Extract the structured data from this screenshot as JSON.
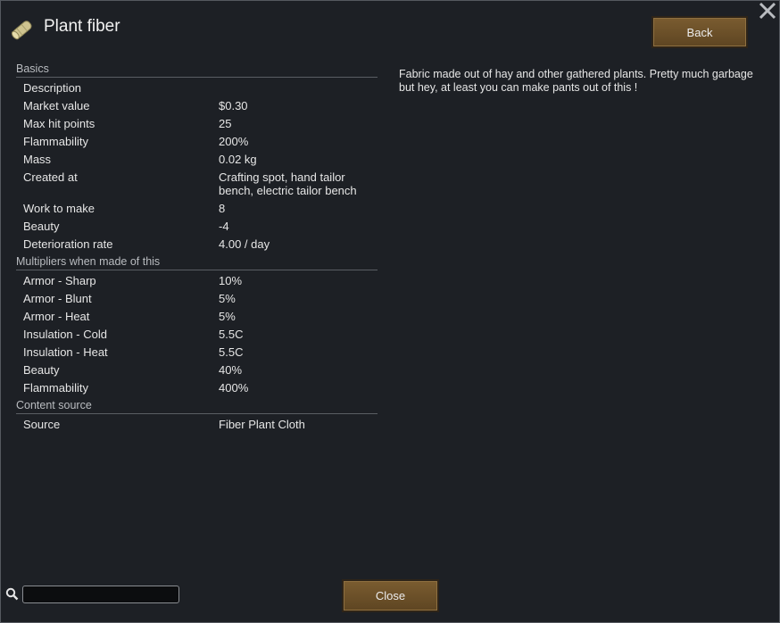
{
  "title": "Plant fiber",
  "buttons": {
    "back": "Back",
    "close": "Close"
  },
  "description": "Fabric made out of hay and other gathered plants. Pretty much garbage but hey, at least you can make pants out of this !",
  "search": {
    "value": "",
    "placeholder": ""
  },
  "icons": {
    "title": "plant-fiber-icon",
    "close": "close-icon",
    "search": "search-icon"
  },
  "colors": {
    "background": "#1d2025",
    "button": "#6b4f28",
    "border": "#55595f"
  },
  "sections": [
    {
      "heading": "Basics",
      "rows": [
        {
          "label": "Description",
          "value": ""
        },
        {
          "label": "Market value",
          "value": "$0.30"
        },
        {
          "label": "Max hit points",
          "value": "25"
        },
        {
          "label": "Flammability",
          "value": "200%"
        },
        {
          "label": "Mass",
          "value": "0.02 kg"
        },
        {
          "label": "Created at",
          "value": "Crafting spot, hand tailor bench, electric tailor bench"
        },
        {
          "label": "Work to make",
          "value": "8"
        },
        {
          "label": "Beauty",
          "value": "-4"
        },
        {
          "label": "Deterioration rate",
          "value": "4.00 / day"
        }
      ]
    },
    {
      "heading": "Multipliers when made of this",
      "rows": [
        {
          "label": "Armor - Sharp",
          "value": "10%"
        },
        {
          "label": "Armor - Blunt",
          "value": "5%"
        },
        {
          "label": "Armor - Heat",
          "value": "5%"
        },
        {
          "label": "Insulation - Cold",
          "value": "5.5C"
        },
        {
          "label": "Insulation - Heat",
          "value": "5.5C"
        },
        {
          "label": "Beauty",
          "value": "40%"
        },
        {
          "label": "Flammability",
          "value": "400%"
        }
      ]
    },
    {
      "heading": "Content source",
      "rows": [
        {
          "label": "Source",
          "value": "Fiber Plant Cloth"
        }
      ]
    }
  ]
}
